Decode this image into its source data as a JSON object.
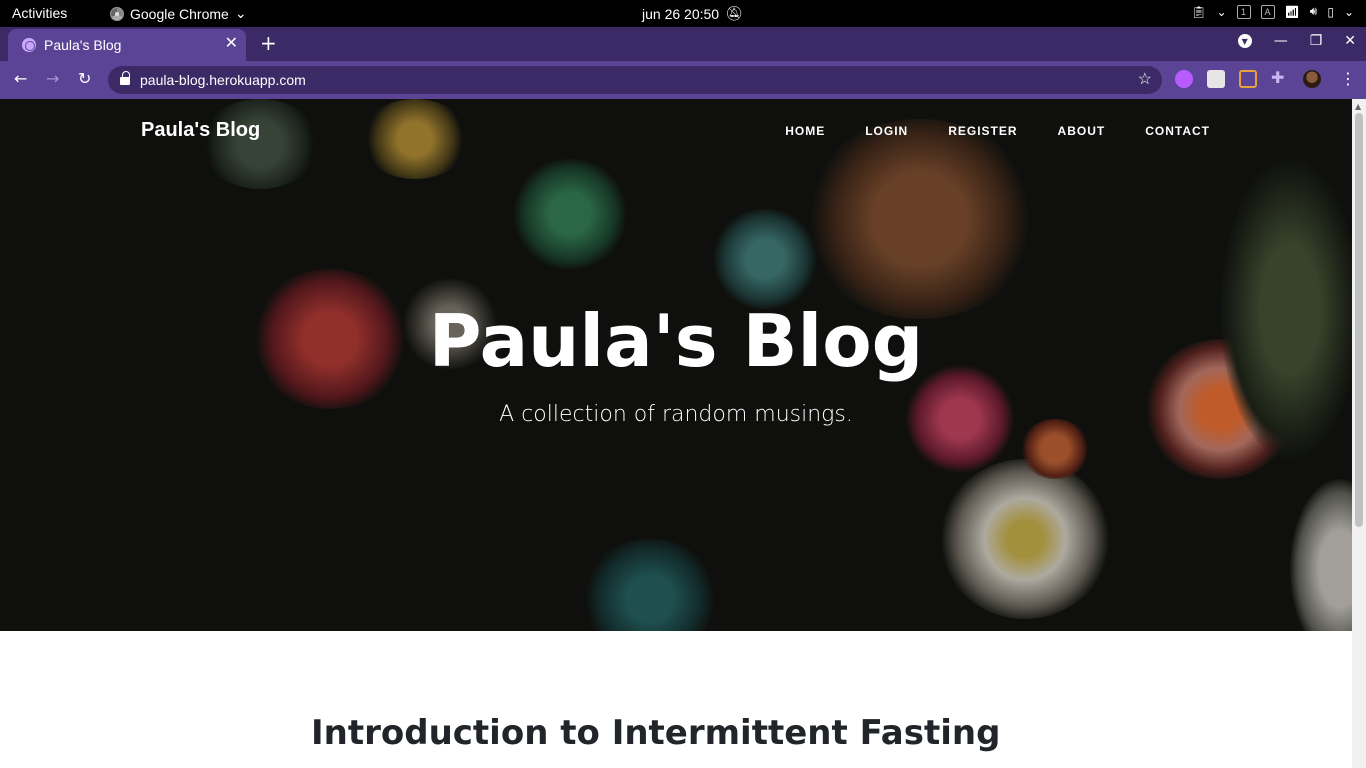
{
  "system": {
    "activities": "Activities",
    "app_name": "Google Chrome",
    "clock": "jun 26  20:50",
    "tray_boxes": [
      "1",
      "A"
    ]
  },
  "browser": {
    "tab_title": "Paula's Blog",
    "url": "paula-blog.herokuapp.com"
  },
  "site": {
    "brand": "Paula's Blog",
    "nav": [
      "HOME",
      "LOGIN",
      "REGISTER",
      "ABOUT",
      "CONTACT"
    ],
    "hero_title": "Paula's Blog",
    "hero_subtitle": "A collection of random musings.",
    "first_post_title": "Introduction to Intermittent Fasting"
  },
  "colors": {
    "tabstrip": "#3c2a67",
    "toolbar": "#5b4496",
    "hero_bg": "#141612"
  }
}
